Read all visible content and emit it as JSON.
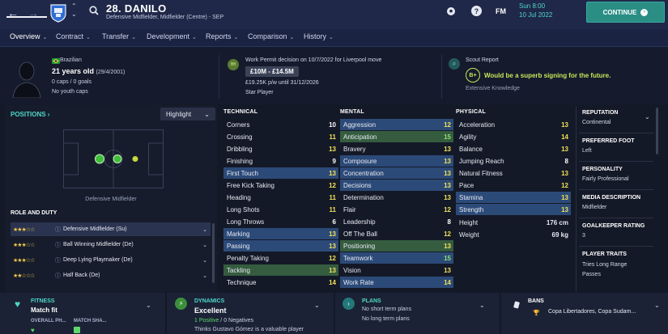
{
  "header": {
    "player_name": "28. DANILO",
    "player_position": "Defensive Midfielder, Midfielder (Centre) - SEP",
    "time": "Sun 8:00",
    "date": "10 Jul 2022",
    "fm_label": "FM",
    "continue_label": "CONTINUE"
  },
  "nav": [
    {
      "label": "Overview"
    },
    {
      "label": "Contract"
    },
    {
      "label": "Transfer"
    },
    {
      "label": "Development"
    },
    {
      "label": "Reports"
    },
    {
      "label": "Comparison"
    },
    {
      "label": "History"
    }
  ],
  "profile": {
    "nationality": "Brazilian",
    "age": "21 years old",
    "dob": "(29/4/2001)",
    "caps": "0 caps / 0 goals",
    "youth_caps": "No youth caps"
  },
  "transfer": {
    "work_permit": "Work Permit decision on 10/7/2022 for Liverpool move",
    "value": "£10M - £14.5M",
    "wage": "£19.25K p/w until 31/12/2026",
    "status": "Star Player"
  },
  "scout": {
    "title": "Scout Report",
    "grade": "B+",
    "verdict": "Would be a superb signing for the future.",
    "knowledge": "Extensive Knowledge"
  },
  "positions": {
    "title": "POSITIONS",
    "highlight_label": "Highlight",
    "pitch_label": "Defensive Midfielder"
  },
  "roles": {
    "title": "ROLE AND DUTY",
    "items": [
      {
        "stars": "★★★☆☆",
        "label": "Defensive Midfielder (Su)"
      },
      {
        "stars": "★★★☆☆",
        "label": "Ball Winning Midfielder (De)"
      },
      {
        "stars": "★★★☆☆",
        "label": "Deep Lying Playmaker (De)"
      },
      {
        "stars": "★★☆☆☆",
        "label": "Half Back (De)"
      }
    ]
  },
  "technical": {
    "title": "TECHNICAL",
    "rows": [
      {
        "label": "Corners",
        "value": "10"
      },
      {
        "label": "Crossing",
        "value": "11"
      },
      {
        "label": "Dribbling",
        "value": "13"
      },
      {
        "label": "Finishing",
        "value": "9"
      },
      {
        "label": "First Touch",
        "value": "13"
      },
      {
        "label": "Free Kick Taking",
        "value": "12"
      },
      {
        "label": "Heading",
        "value": "11"
      },
      {
        "label": "Long Shots",
        "value": "11"
      },
      {
        "label": "Long Throws",
        "value": "6"
      },
      {
        "label": "Marking",
        "value": "13"
      },
      {
        "label": "Passing",
        "value": "13"
      },
      {
        "label": "Penalty Taking",
        "value": "12"
      },
      {
        "label": "Tackling",
        "value": "13"
      },
      {
        "label": "Technique",
        "value": "14"
      }
    ]
  },
  "mental": {
    "title": "MENTAL",
    "rows": [
      {
        "label": "Aggression",
        "value": "12"
      },
      {
        "label": "Anticipation",
        "value": "15"
      },
      {
        "label": "Bravery",
        "value": "13"
      },
      {
        "label": "Composure",
        "value": "13"
      },
      {
        "label": "Concentration",
        "value": "13"
      },
      {
        "label": "Decisions",
        "value": "13"
      },
      {
        "label": "Determination",
        "value": "13"
      },
      {
        "label": "Flair",
        "value": "12"
      },
      {
        "label": "Leadership",
        "value": "8"
      },
      {
        "label": "Off The Ball",
        "value": "12"
      },
      {
        "label": "Positioning",
        "value": "13"
      },
      {
        "label": "Teamwork",
        "value": "15"
      },
      {
        "label": "Vision",
        "value": "13"
      },
      {
        "label": "Work Rate",
        "value": "14"
      }
    ]
  },
  "physical": {
    "title": "PHYSICAL",
    "rows": [
      {
        "label": "Acceleration",
        "value": "13"
      },
      {
        "label": "Agility",
        "value": "14"
      },
      {
        "label": "Balance",
        "value": "13"
      },
      {
        "label": "Jumping Reach",
        "value": "8"
      },
      {
        "label": "Natural Fitness",
        "value": "13"
      },
      {
        "label": "Pace",
        "value": "12"
      },
      {
        "label": "Stamina",
        "value": "13"
      },
      {
        "label": "Strength",
        "value": "13"
      }
    ],
    "height_label": "Height",
    "height_value": "176 cm",
    "weight_label": "Weight",
    "weight_value": "69 kg"
  },
  "info": {
    "reputation_title": "REPUTATION",
    "reputation_value": "Continental",
    "foot_title": "PREFERRED FOOT",
    "foot_value": "Left",
    "personality_title": "PERSONALITY",
    "personality_value": "Fairly Professional",
    "media_title": "MEDIA DESCRIPTION",
    "media_value": "Midfielder",
    "gk_title": "GOALKEEPER RATING",
    "gk_value": "3",
    "traits_title": "PLAYER TRAITS",
    "traits_value_1": "Tries Long Range",
    "traits_value_2": "Passes"
  },
  "bottom": {
    "fitness_title": "FITNESS",
    "fitness_value": "Match fit",
    "overall_label": "OVERALL PH...",
    "sharpness_label": "MATCH SHA...",
    "dynamics_title": "DYNAMICS",
    "dynamics_value": "Excellent",
    "positives": "1 Positive",
    "negatives": " / 0 Negatives",
    "dynamics_note": "Thinks Gustavo Gómez is a valuable player",
    "plans_title": "PLANS",
    "plans_short": "No short term plans",
    "plans_long": "No long term plans",
    "bans_title": "BANS",
    "bans_value": "Copa Libertadores, Copa Sudam..."
  },
  "colors": {
    "accent": "#4fd7c6",
    "header_bg": "#1f2848",
    "attr_yellow": "#f1e25a",
    "attr_green": "#8fe070",
    "scout_green": "#c6e65a",
    "star": "#f1c84b"
  }
}
